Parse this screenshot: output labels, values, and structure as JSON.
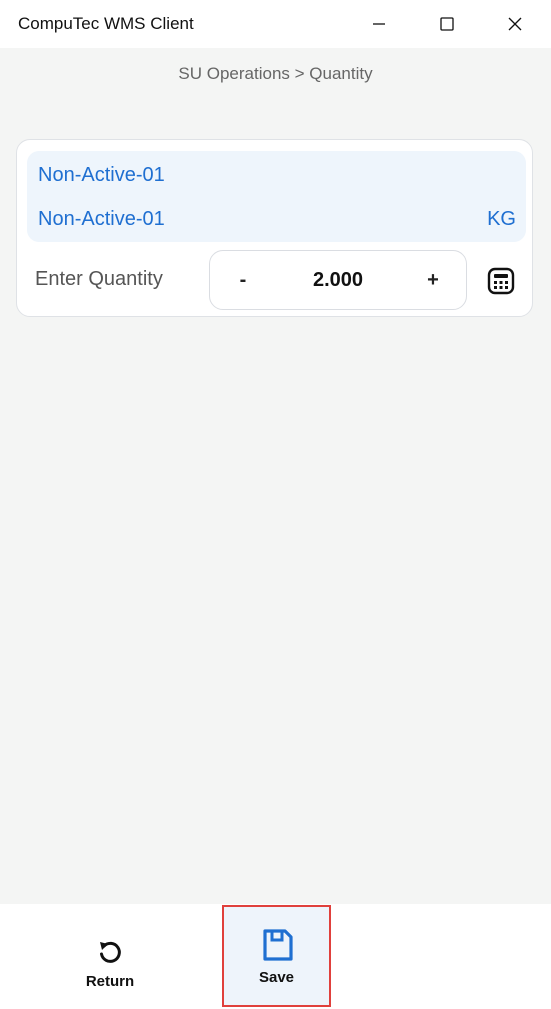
{
  "window": {
    "title": "CompuTec WMS Client",
    "controls": [
      "minimize-icon",
      "maximize-icon",
      "close-icon"
    ]
  },
  "breadcrumb": "SU Operations > Quantity",
  "item": {
    "line1": "Non-Active-01",
    "line2": "Non-Active-01",
    "uom": "KG"
  },
  "quantity": {
    "label": "Enter Quantity",
    "decrement": "-",
    "value": "2.000",
    "increment": "+",
    "calculator_icon": "calculator-icon"
  },
  "bottom_bar": {
    "return_label": "Return",
    "return_icon": "undo-icon",
    "save_label": "Save",
    "save_icon": "floppy-disk-icon"
  },
  "colors": {
    "accent": "#1f6fd1",
    "highlight_border": "#e0403c"
  }
}
